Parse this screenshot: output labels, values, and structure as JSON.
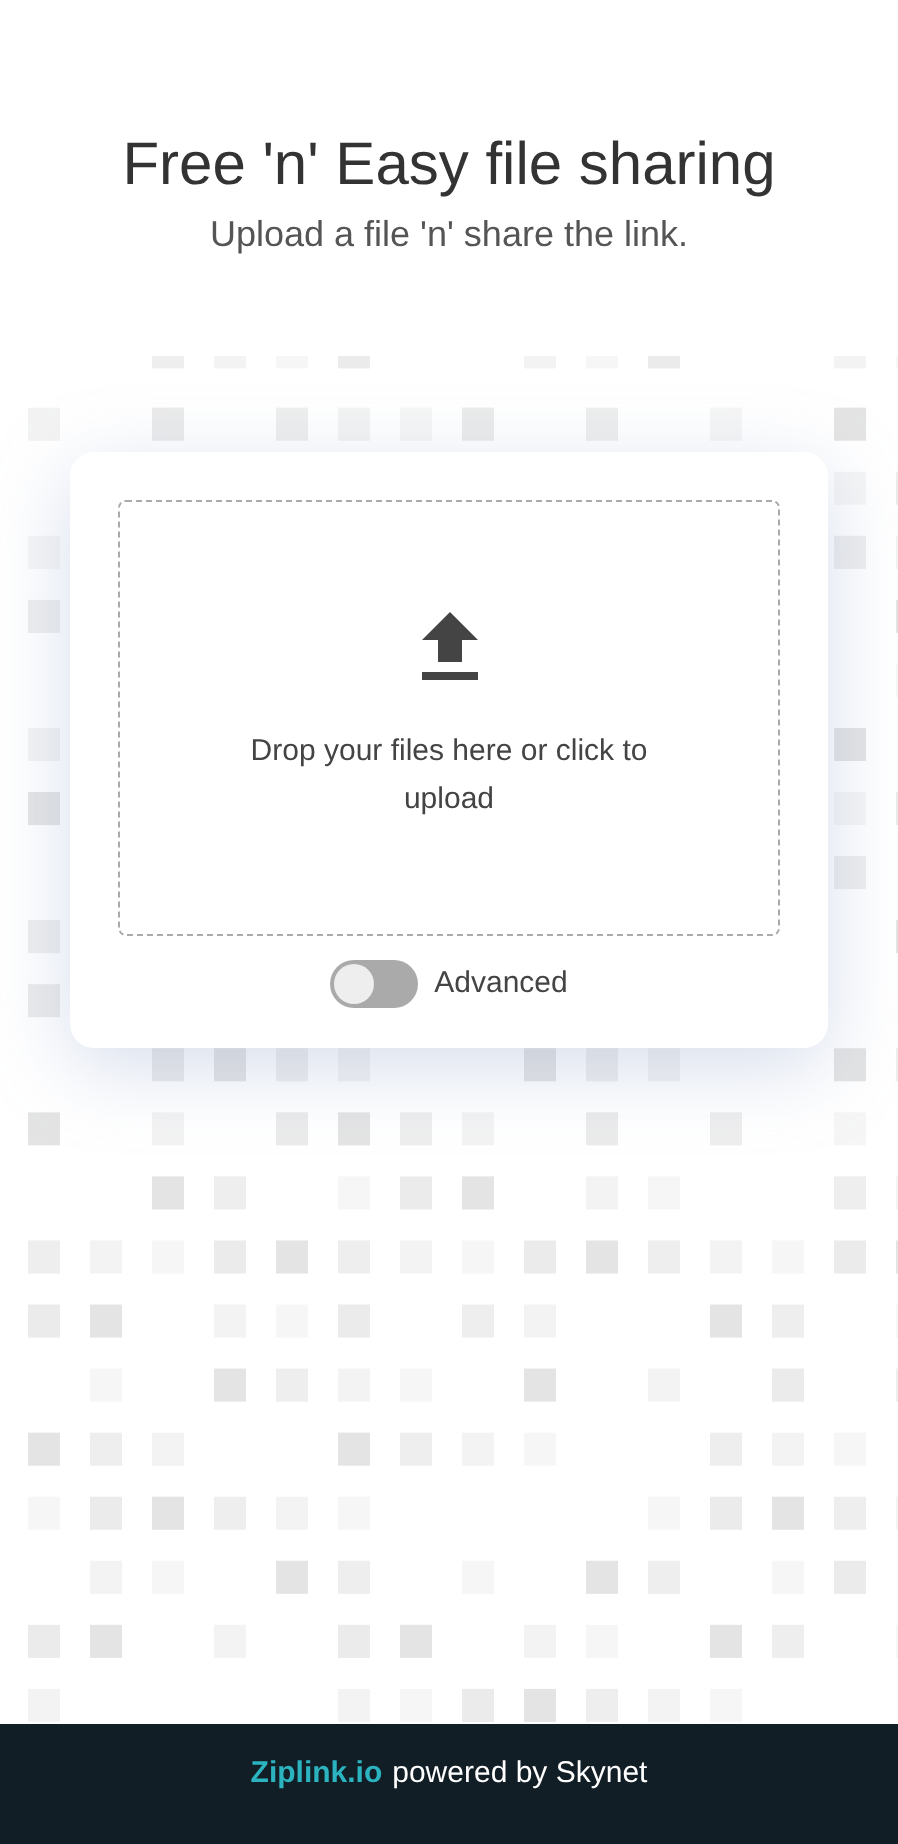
{
  "header": {
    "title": "Free 'n' Easy file sharing",
    "subtitle": "Upload a file 'n' share the link."
  },
  "upload": {
    "hint": "Drop your files here or click to upload",
    "advanced": {
      "label": "Advanced",
      "on": false
    }
  },
  "footer": {
    "brand": "Ziplink.io",
    "tagline": "powered by Skynet"
  }
}
